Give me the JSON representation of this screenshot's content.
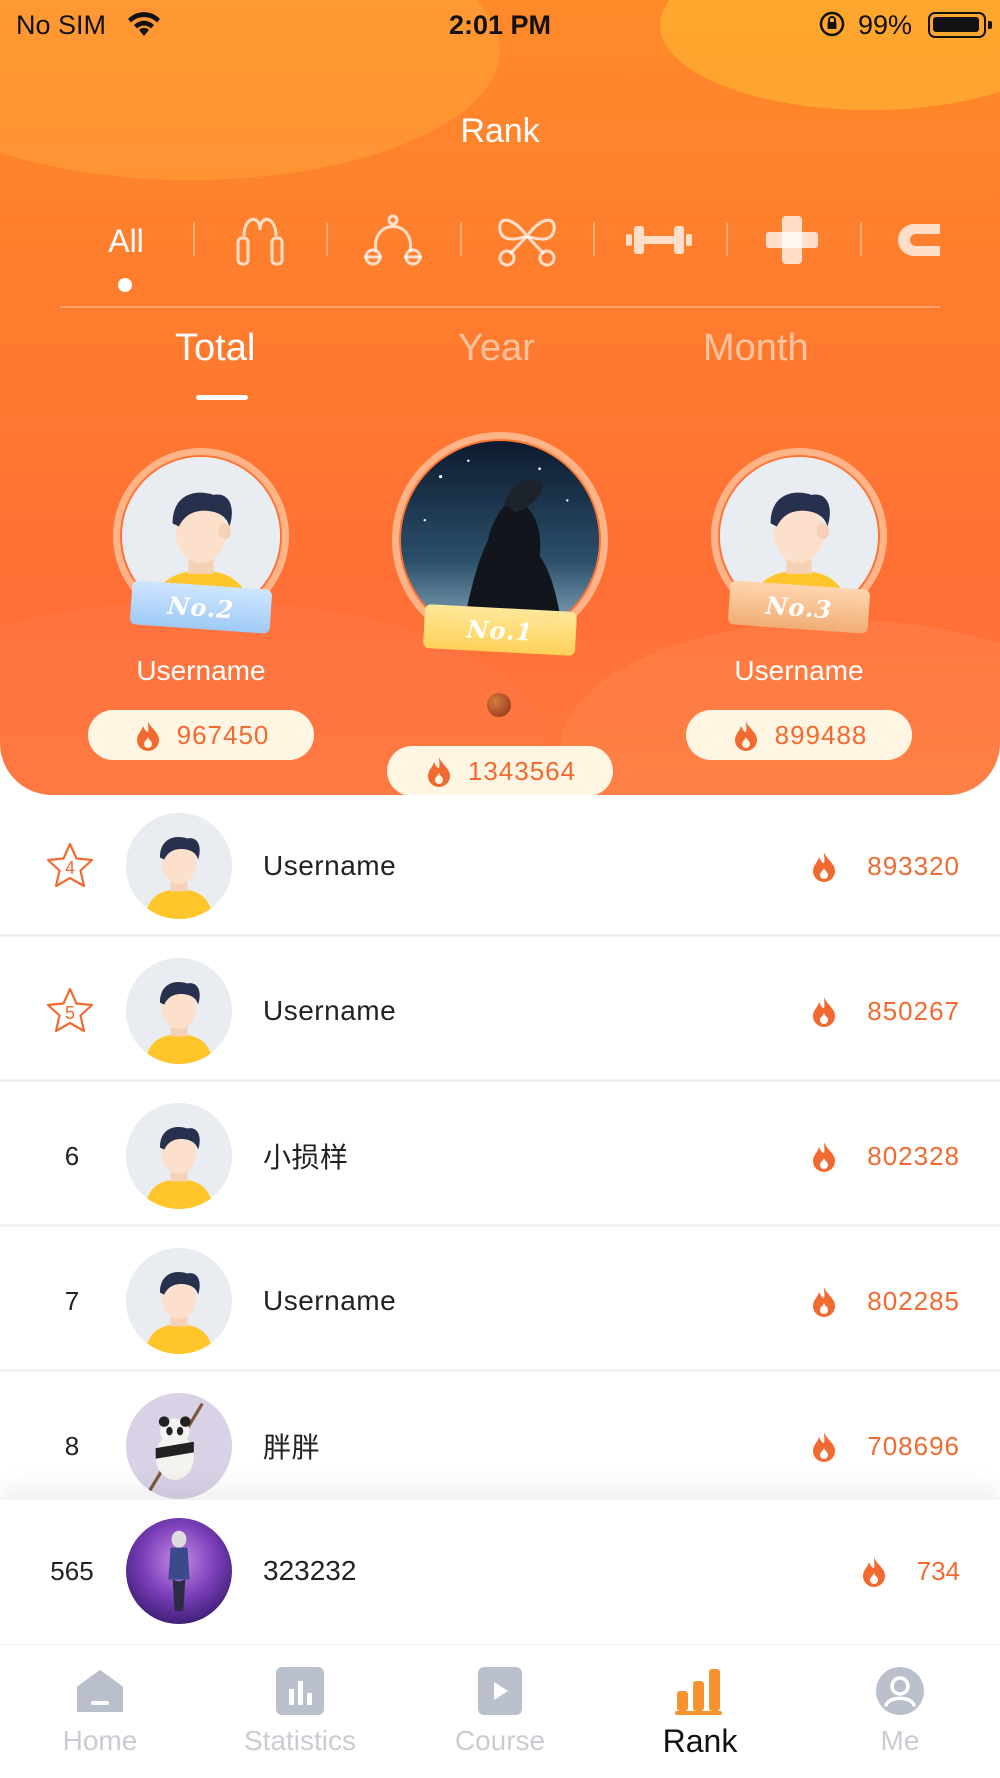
{
  "status_bar": {
    "carrier": "No SIM",
    "time": "2:01 PM",
    "battery": "99%"
  },
  "header": {
    "title": "Rank"
  },
  "categories": {
    "all_label": "All",
    "icons": [
      "jump-rope-icon",
      "resistance-band-icon",
      "figure-eight-band-icon",
      "dumbbell-icon",
      "barbell-plate-icon",
      "grip-icon"
    ]
  },
  "periods": {
    "items": [
      "Total",
      "Year",
      "Month"
    ],
    "active": "Total"
  },
  "podium": {
    "first": {
      "badge": "No.1",
      "name": "",
      "score": "1343564"
    },
    "second": {
      "badge": "No.2",
      "name": "Username",
      "score": "967450"
    },
    "third": {
      "badge": "No.3",
      "name": "Username",
      "score": "899488"
    }
  },
  "list": [
    {
      "rank": "4",
      "name": "Username",
      "score": "893320"
    },
    {
      "rank": "5",
      "name": "Username",
      "score": "850267"
    },
    {
      "rank": "6",
      "name": "小损样",
      "score": "802328"
    },
    {
      "rank": "7",
      "name": "Username",
      "score": "802285"
    },
    {
      "rank": "8",
      "name": "胖胖",
      "score": "708696"
    }
  ],
  "my_rank": {
    "rank": "565",
    "name": "323232",
    "score": "734"
  },
  "tab_bar": {
    "items": [
      "Home",
      "Statistics",
      "Course",
      "Rank",
      "Me"
    ],
    "active": "Rank"
  },
  "colors": {
    "accent": "#f26a2f",
    "header_orange": "#ff7a2e",
    "tab_inactive": "#c9ccd1",
    "tab_active_icon": "#f7922f"
  }
}
